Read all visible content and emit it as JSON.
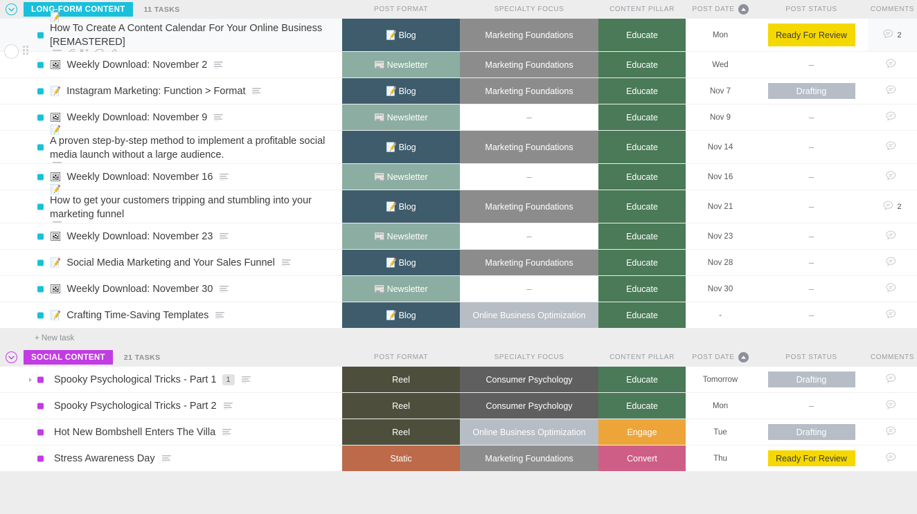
{
  "columns": [
    {
      "key": "post_format",
      "label": "POST FORMAT"
    },
    {
      "key": "specialty_focus",
      "label": "SPECIALTY FOCUS"
    },
    {
      "key": "content_pillar",
      "label": "CONTENT PILLAR"
    },
    {
      "key": "post_date",
      "label": "POST DATE",
      "sort": "ascending"
    },
    {
      "key": "post_status",
      "label": "POST STATUS"
    },
    {
      "key": "comments",
      "label": "COMMENTS"
    }
  ],
  "colors": {
    "group1_accent": "#19c0db",
    "group2_accent": "#c13ce3",
    "blog": "#3e5c6b",
    "newsletter": "#8cada2",
    "reel": "#4d4f3c",
    "static": "#bc6a4a",
    "marketing_foundations": "#8c8c8c",
    "consumer_psychology": "#5f5f5f",
    "online_business_optimization": "#b6bdc4",
    "educate": "#4a7a57",
    "engage": "#eda53a",
    "convert": "#ce5e86",
    "ready_for_review": "#f5d800",
    "drafting": "#b7bdc6"
  },
  "new_task_label": "+ New task",
  "groups": [
    {
      "name": "LONG-FORM CONTENT",
      "count_label": "11 TASKS",
      "accent": "#19c0db",
      "rows": [
        {
          "emoji": "📝",
          "title": "How To Create A Content Calendar For Your Online Business [REMASTERED]",
          "selected": true,
          "icons": [
            "description-icon",
            "attachment-icon",
            "subtask-icon",
            "tag-icon",
            "edit-icon"
          ],
          "post_format": "Blog",
          "format_emoji": "📝",
          "specialty_focus": "Marketing Foundations",
          "content_pillar": "Educate",
          "post_date": "Mon",
          "post_status": "Ready For Review",
          "comments": "2"
        },
        {
          "emoji": "🖼",
          "title": "Weekly Download: November 2",
          "icons": [
            "description-icon"
          ],
          "post_format": "Newsletter",
          "format_emoji": "📰",
          "specialty_focus": "Marketing Foundations",
          "content_pillar": "Educate",
          "post_date": "Wed",
          "post_status": "–",
          "comments": ""
        },
        {
          "emoji": "📝",
          "title": "Instagram Marketing: Function > Format",
          "icons": [
            "description-icon"
          ],
          "post_format": "Blog",
          "format_emoji": "📝",
          "specialty_focus": "Marketing Foundations",
          "content_pillar": "Educate",
          "post_date": "Nov 7",
          "post_status": "Drafting",
          "comments": ""
        },
        {
          "emoji": "🖼",
          "title": "Weekly Download: November 9",
          "icons": [
            "description-icon"
          ],
          "post_format": "Newsletter",
          "format_emoji": "📰",
          "specialty_focus": "–",
          "content_pillar": "Educate",
          "post_date": "Nov 9",
          "post_status": "–",
          "comments": ""
        },
        {
          "emoji": "📝",
          "title": "A proven step-by-step method to implement a profitable social media launch without a large audience.",
          "icons": [
            "description-icon"
          ],
          "post_format": "Blog",
          "format_emoji": "📝",
          "specialty_focus": "Marketing Foundations",
          "content_pillar": "Educate",
          "post_date": "Nov 14",
          "post_status": "–",
          "comments": ""
        },
        {
          "emoji": "🖼",
          "title": "Weekly Download: November 16",
          "icons": [
            "description-icon"
          ],
          "post_format": "Newsletter",
          "format_emoji": "📰",
          "specialty_focus": "–",
          "content_pillar": "Educate",
          "post_date": "Nov 16",
          "post_status": "–",
          "comments": ""
        },
        {
          "emoji": "📝",
          "title": "How to get your customers tripping and stumbling into your marketing funnel",
          "icons": [
            "description-icon"
          ],
          "post_format": "Blog",
          "format_emoji": "📝",
          "specialty_focus": "Marketing Foundations",
          "content_pillar": "Educate",
          "post_date": "Nov 21",
          "post_status": "–",
          "comments": "2"
        },
        {
          "emoji": "🖼",
          "title": "Weekly Download: November 23",
          "icons": [
            "description-icon"
          ],
          "post_format": "Newsletter",
          "format_emoji": "📰",
          "specialty_focus": "–",
          "content_pillar": "Educate",
          "post_date": "Nov 23",
          "post_status": "–",
          "comments": ""
        },
        {
          "emoji": "📝",
          "title": "Social Media Marketing and Your Sales Funnel",
          "icons": [
            "description-icon"
          ],
          "post_format": "Blog",
          "format_emoji": "📝",
          "specialty_focus": "Marketing Foundations",
          "content_pillar": "Educate",
          "post_date": "Nov 28",
          "post_status": "–",
          "comments": ""
        },
        {
          "emoji": "🖼",
          "title": "Weekly Download: November 30",
          "icons": [
            "description-icon"
          ],
          "post_format": "Newsletter",
          "format_emoji": "📰",
          "specialty_focus": "–",
          "content_pillar": "Educate",
          "post_date": "Nov 30",
          "post_status": "–",
          "comments": ""
        },
        {
          "emoji": "📝",
          "title": "Crafting Time-Saving Templates",
          "icons": [
            "description-icon"
          ],
          "post_format": "Blog",
          "format_emoji": "📝",
          "specialty_focus": "Online Business Optimization",
          "content_pillar": "Educate",
          "post_date": "-",
          "post_status": "–",
          "comments": ""
        }
      ]
    },
    {
      "name": "SOCIAL CONTENT",
      "count_label": "21 TASKS",
      "accent": "#c13ce3",
      "rows": [
        {
          "title": "Spooky Psychological Tricks - Part 1",
          "expandable": true,
          "subtask_count": "1",
          "icons": [
            "description-icon"
          ],
          "post_format": "Reel",
          "specialty_focus": "Consumer Psychology",
          "content_pillar": "Educate",
          "post_date": "Tomorrow",
          "post_status": "Drafting",
          "comments": ""
        },
        {
          "title": "Spooky Psychological Tricks - Part 2",
          "icons": [
            "description-icon"
          ],
          "post_format": "Reel",
          "specialty_focus": "Consumer Psychology",
          "content_pillar": "Educate",
          "post_date": "Mon",
          "post_status": "–",
          "comments": ""
        },
        {
          "title": "Hot New Bombshell Enters The Villa",
          "icons": [
            "description-icon"
          ],
          "post_format": "Reel",
          "specialty_focus": "Online Business Optimization",
          "content_pillar": "Engage",
          "post_date": "Tue",
          "post_status": "Drafting",
          "comments": ""
        },
        {
          "title": "Stress Awareness Day",
          "icons": [
            "description-icon"
          ],
          "post_format": "Static",
          "specialty_focus": "Marketing Foundations",
          "content_pillar": "Convert",
          "post_date": "Thu",
          "post_status": "Ready For Review",
          "comments": ""
        }
      ]
    }
  ]
}
